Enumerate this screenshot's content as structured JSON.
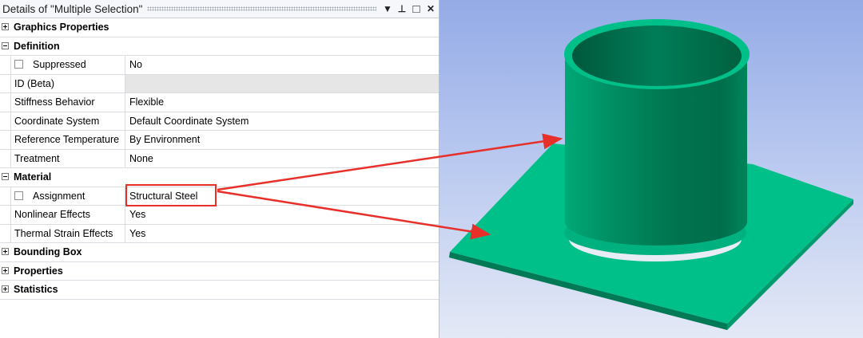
{
  "panel": {
    "title": "Details of \"Multiple Selection\"",
    "title_buttons": [
      {
        "name": "dropdown-arrow-icon",
        "glyph": "▼"
      },
      {
        "name": "pin-icon",
        "glyph": "⊥"
      },
      {
        "name": "maximize-icon",
        "glyph": "□"
      },
      {
        "name": "close-icon",
        "glyph": "✕"
      }
    ]
  },
  "groups": {
    "graphics_properties": {
      "label": "Graphics Properties",
      "expanded": false
    },
    "definition": {
      "label": "Definition",
      "expanded": true,
      "rows": {
        "suppressed": {
          "label": "Suppressed",
          "value": "No"
        },
        "id": {
          "label": "ID (Beta)",
          "value": ""
        },
        "stiffness": {
          "label": "Stiffness Behavior",
          "value": "Flexible"
        },
        "coordinate": {
          "label": "Coordinate System",
          "value": "Default Coordinate System"
        },
        "reference_temp": {
          "label": "Reference Temperature",
          "value": "By Environment"
        },
        "treatment": {
          "label": "Treatment",
          "value": "None"
        }
      }
    },
    "material": {
      "label": "Material",
      "expanded": true,
      "rows": {
        "assignment": {
          "label": "Assignment",
          "value": "Structural Steel"
        },
        "nonlinear": {
          "label": "Nonlinear Effects",
          "value": "Yes"
        },
        "thermal": {
          "label": "Thermal Strain Effects",
          "value": "Yes"
        }
      }
    },
    "bounding_box": {
      "label": "Bounding Box",
      "expanded": false
    },
    "properties": {
      "label": "Properties",
      "expanded": false
    },
    "statistics": {
      "label": "Statistics",
      "expanded": false
    }
  },
  "colors": {
    "highlight": "#e8302a",
    "body_green": "#00c08a",
    "background_top": "#94abe6",
    "background_bottom": "#e4e9f6"
  }
}
